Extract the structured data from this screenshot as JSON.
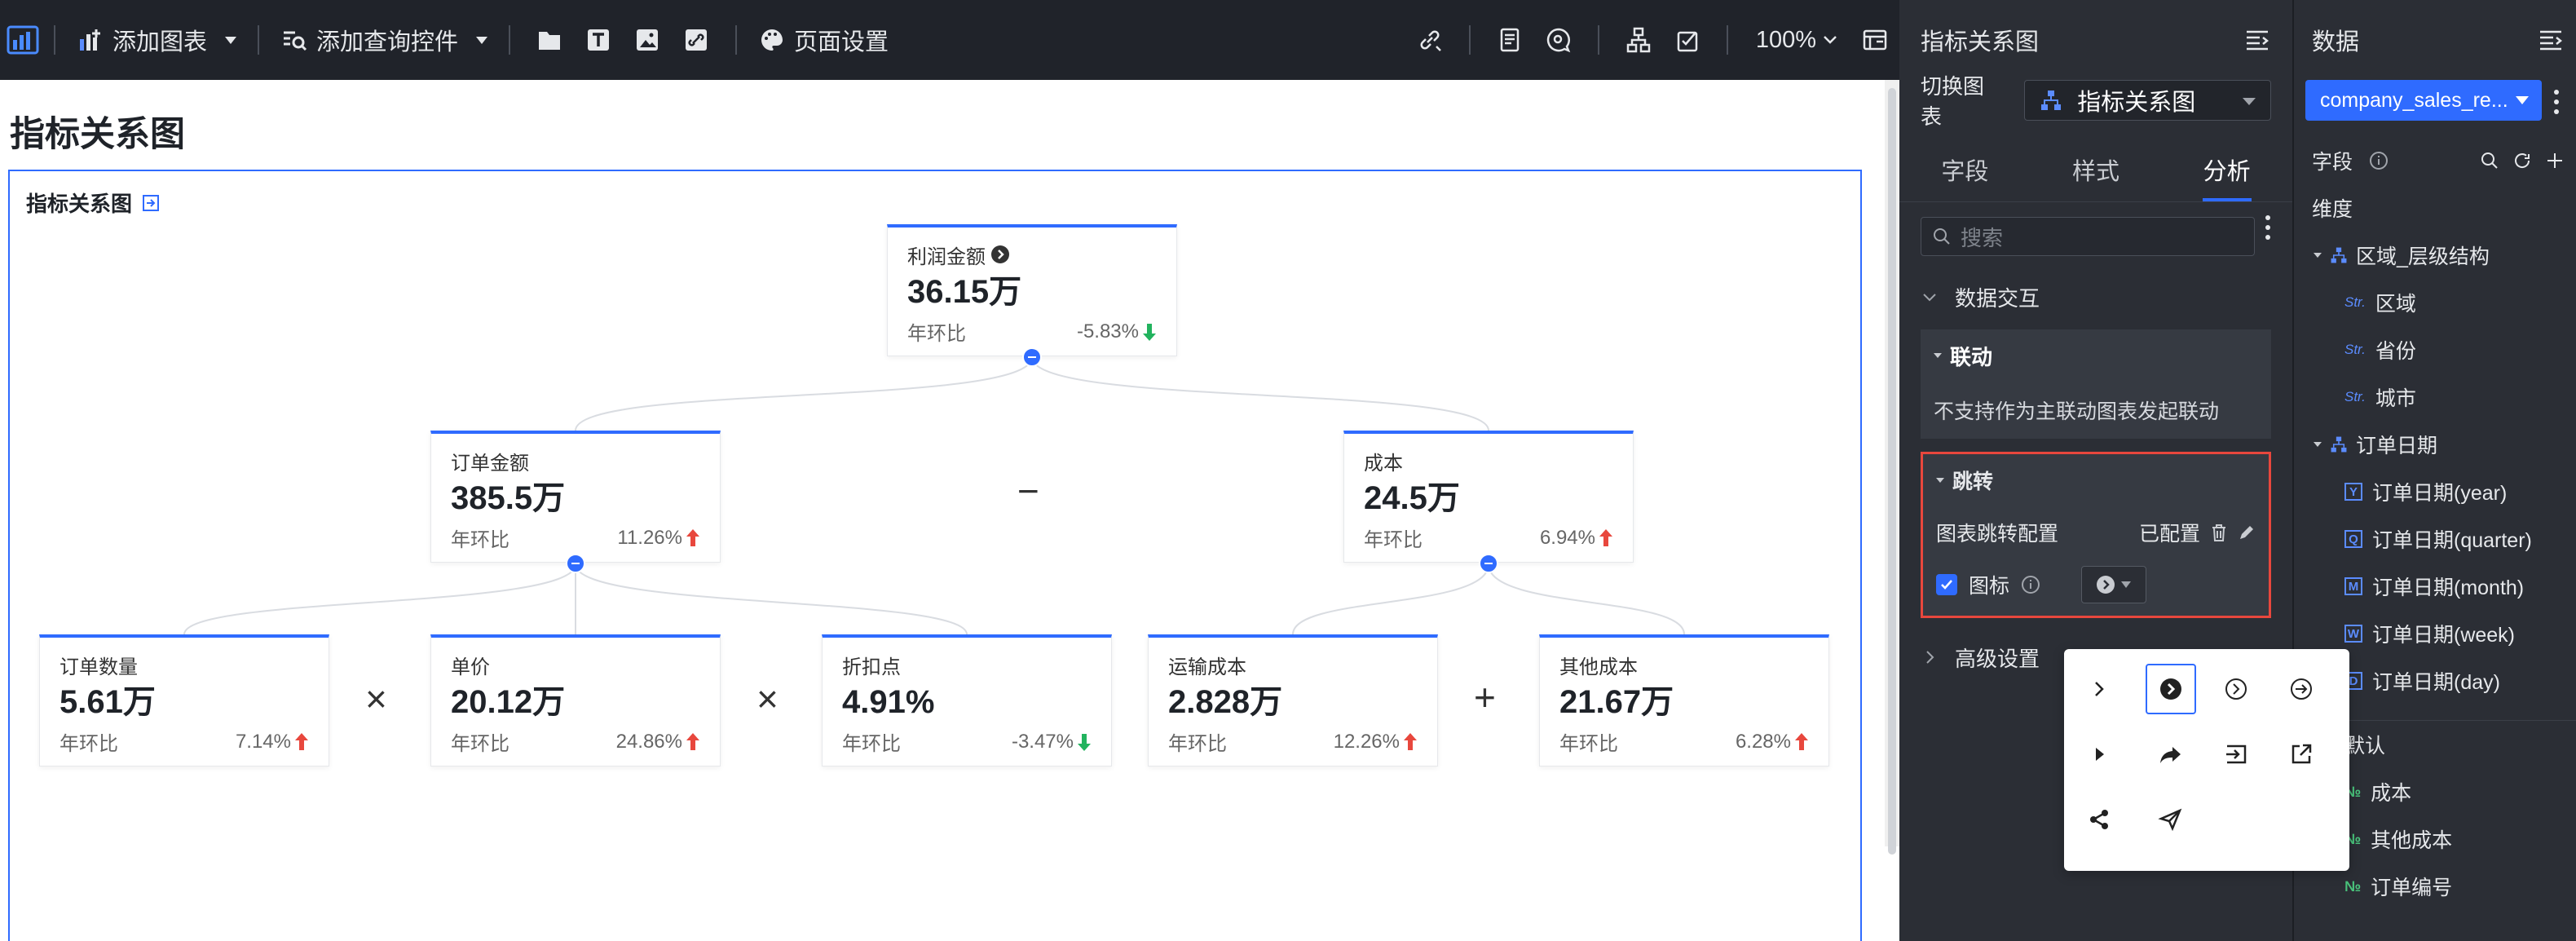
{
  "toolbar": {
    "add_chart": "添加图表",
    "add_query": "添加查询控件",
    "page_settings": "页面设置",
    "zoom": "100%"
  },
  "page": {
    "title": "指标关系图",
    "chart_title": "指标关系图"
  },
  "cards": {
    "profit": {
      "name": "利润金额",
      "value": "36.15万",
      "label": "年环比",
      "change": "-5.83%",
      "dir": "down"
    },
    "order_amount": {
      "name": "订单金额",
      "value": "385.5万",
      "label": "年环比",
      "change": "11.26%",
      "dir": "up"
    },
    "cost": {
      "name": "成本",
      "value": "24.5万",
      "label": "年环比",
      "change": "6.94%",
      "dir": "up"
    },
    "order_qty": {
      "name": "订单数量",
      "value": "5.61万",
      "label": "年环比",
      "change": "7.14%",
      "dir": "up"
    },
    "unit_price": {
      "name": "单价",
      "value": "20.12万",
      "label": "年环比",
      "change": "24.86%",
      "dir": "up"
    },
    "discount": {
      "name": "折扣点",
      "value": "4.91%",
      "label": "年环比",
      "change": "-3.47%",
      "dir": "down"
    },
    "shipping": {
      "name": "运输成本",
      "value": "2.828万",
      "label": "年环比",
      "change": "12.26%",
      "dir": "up"
    },
    "other_cost": {
      "name": "其他成本",
      "value": "21.67万",
      "label": "年环比",
      "change": "6.28%",
      "dir": "up"
    }
  },
  "operators": {
    "minus": "−",
    "times1": "×",
    "times2": "×",
    "plus": "+"
  },
  "config_panel": {
    "title": "指标关系图",
    "switch_label": "切换图表",
    "switch_value": "指标关系图",
    "tabs": [
      "字段",
      "样式",
      "分析"
    ],
    "search_placeholder": "搜索",
    "section_interaction": "数据交互",
    "linkage_title": "联动",
    "linkage_note": "不支持作为主联动图表发起联动",
    "jump_title": "跳转",
    "jump_config_label": "图表跳转配置",
    "jump_config_status": "已配置",
    "icon_label": "图标",
    "advanced": "高级设置"
  },
  "data_panel": {
    "title": "数据",
    "dataset": "company_sales_re...",
    "fields_label": "字段",
    "dimension_label": "维度",
    "region_group": "区域_层级结构",
    "region_fields": [
      "区域",
      "省份",
      "城市"
    ],
    "date_group": "订单日期",
    "date_fields": [
      {
        "tag": "Y",
        "name": "订单日期(year)"
      },
      {
        "tag": "Q",
        "name": "订单日期(quarter)"
      },
      {
        "tag": "M",
        "name": "订单日期(month)"
      },
      {
        "tag": "W",
        "name": "订单日期(week)"
      },
      {
        "tag": "D",
        "name": "订单日期(day)"
      }
    ],
    "measure_default": "默认",
    "measures": [
      "成本",
      "其他成本",
      "订单编号"
    ]
  },
  "colors": {
    "accent": "#2f6bff",
    "up": "#e8473d",
    "down": "#22b35e",
    "panel": "#2b2e35"
  }
}
